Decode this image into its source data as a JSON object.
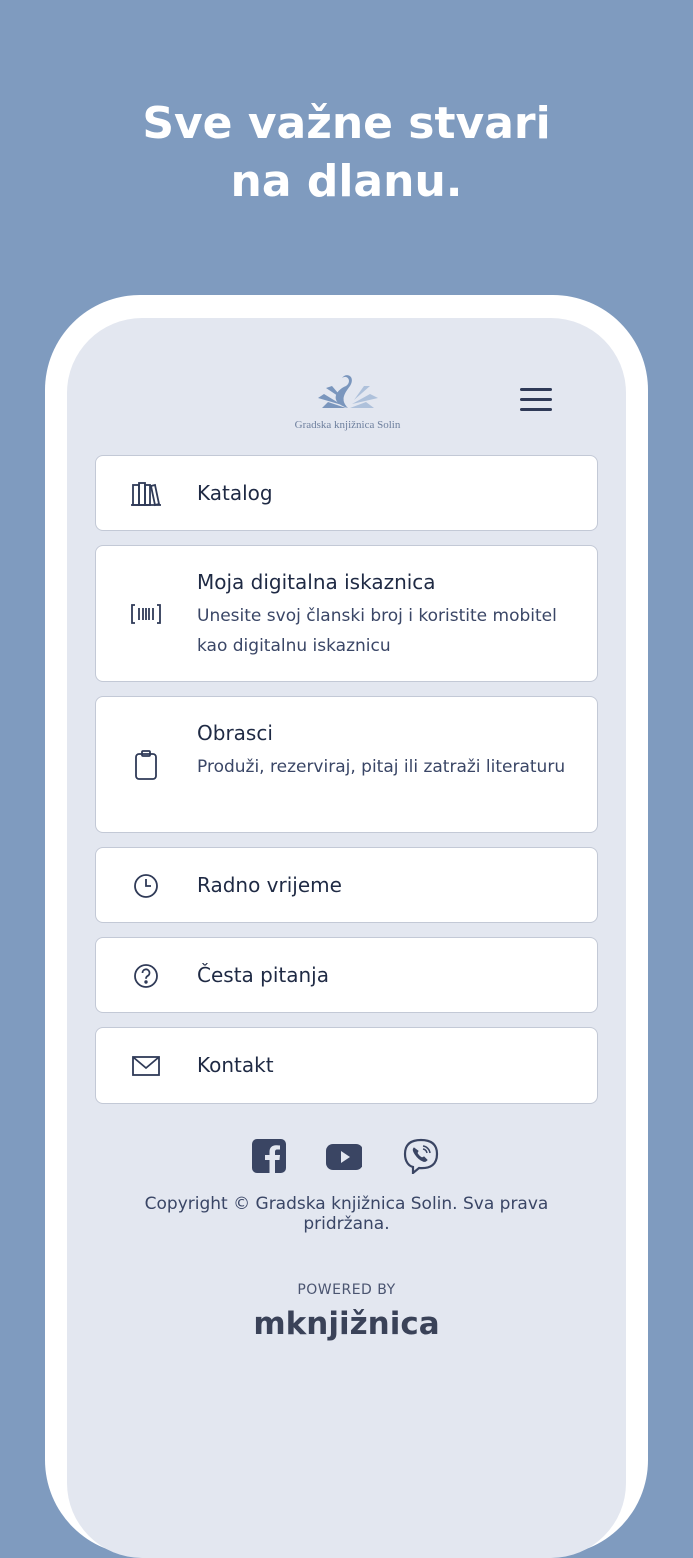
{
  "headline": {
    "line1": "Sve važne stvari",
    "line2": "na dlanu."
  },
  "logo": {
    "text": "Gradska knjižnica Solin"
  },
  "menu_items": [
    {
      "title": "Katalog",
      "icon": "books-icon"
    },
    {
      "title": "Moja digitalna iskaznica",
      "desc": "Unesite svoj članski broj i koristite mobitel kao digitalnu iskaznicu",
      "icon": "barcode-icon"
    },
    {
      "title": "Obrasci",
      "desc": "Produži, rezerviraj, pitaj ili zatraži literaturu",
      "icon": "clipboard-icon"
    },
    {
      "title": "Radno vrijeme",
      "icon": "clock-icon"
    },
    {
      "title": "Česta pitanja",
      "icon": "question-icon"
    },
    {
      "title": "Kontakt",
      "icon": "mail-icon"
    }
  ],
  "footer": {
    "copyright": "Copyright © Gradska knjižnica Solin. Sva prava pridržana.",
    "powered_by": "POWERED BY",
    "brand": "mknjižnica"
  },
  "colors": {
    "background": "#7f9bbf",
    "screen": "#e3e7f0",
    "text": "#1f2a44"
  }
}
